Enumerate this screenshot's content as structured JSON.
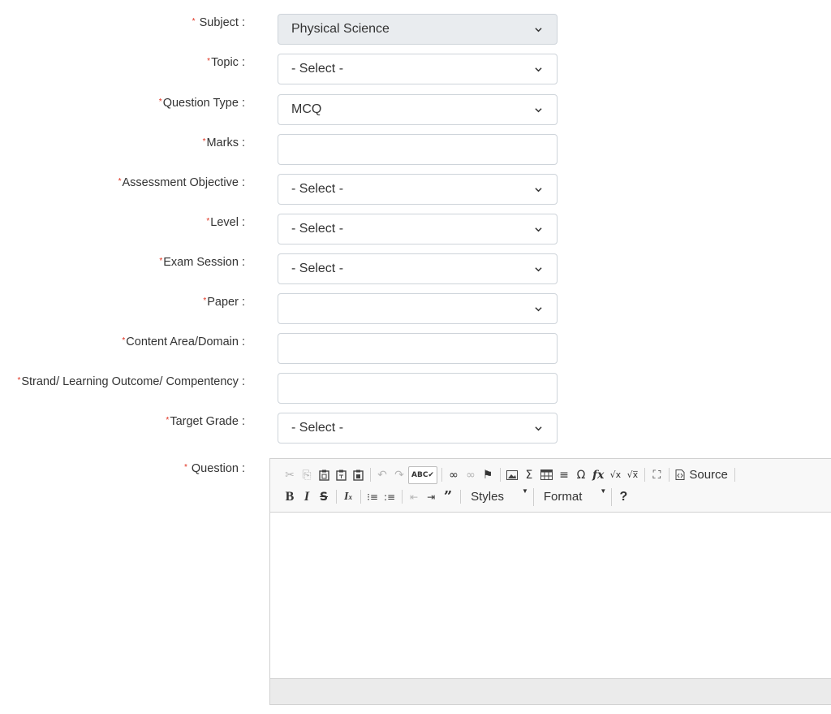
{
  "required_mark": "*",
  "fields": [
    {
      "id": "subject",
      "label": "Subject :",
      "value": "Physical Science",
      "kind": "select",
      "disabled": true
    },
    {
      "id": "topic",
      "label": "Topic :",
      "value": "- Select -",
      "kind": "select"
    },
    {
      "id": "question_type",
      "label": "Question Type :",
      "value": "MCQ",
      "kind": "select"
    },
    {
      "id": "marks",
      "label": "Marks :",
      "value": "",
      "kind": "input"
    },
    {
      "id": "assessment_objective",
      "label": "Assessment Objective :",
      "value": "- Select -",
      "kind": "select"
    },
    {
      "id": "level",
      "label": "Level :",
      "value": "- Select -",
      "kind": "select"
    },
    {
      "id": "exam_session",
      "label": "Exam Session :",
      "value": "- Select -",
      "kind": "select"
    },
    {
      "id": "paper",
      "label": "Paper :",
      "value": "",
      "kind": "select"
    },
    {
      "id": "content_area",
      "label": "Content Area/Domain :",
      "value": "",
      "kind": "input"
    },
    {
      "id": "strand",
      "label": "Strand/ Learning Outcome/ Compentency :",
      "value": "",
      "kind": "input"
    },
    {
      "id": "target_grade",
      "label": "Target Grade :",
      "value": "- Select -",
      "kind": "select"
    }
  ],
  "question": {
    "label": "Question :",
    "toolbar": {
      "source_label": "Source",
      "styles_label": "Styles",
      "format_label": "Format",
      "help_label": "?"
    }
  },
  "colors": {
    "required": "#e0301e",
    "disabled_bg": "#e9ecef",
    "border": "#ced4da"
  }
}
